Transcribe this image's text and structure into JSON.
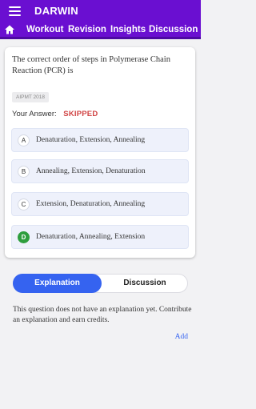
{
  "header": {
    "brand": "DARWIN"
  },
  "nav": {
    "home_icon": "home-icon",
    "items": [
      "Workout",
      "Revision",
      "Insights",
      "Discussion"
    ]
  },
  "question": {
    "text": "The correct order of steps in Polymerase Chain Reaction (PCR) is",
    "tag": "AIPMT 2018",
    "answer_label": "Your Answer:",
    "answer_value": "SKIPPED"
  },
  "options": [
    {
      "letter": "A",
      "text": "Denaturation, Extension, Annealing",
      "correct": false
    },
    {
      "letter": "B",
      "text": "Annealing, Extension, Denaturation",
      "correct": false
    },
    {
      "letter": "C",
      "text": "Extension, Denaturation, Annealing",
      "correct": false
    },
    {
      "letter": "D",
      "text": "Denaturation, Annealing, Extension",
      "correct": true
    }
  ],
  "tabs": {
    "explanation": "Explanation",
    "discussion": "Discussion"
  },
  "explanation": {
    "empty_text": "This question does not have an explanation yet. Contribute an explanation and earn credits.",
    "add_label": "Add"
  },
  "colors": {
    "brand": "#6a0fd1",
    "accent": "#3563f0",
    "skipped": "#d04444",
    "correct": "#2e9e3e"
  }
}
